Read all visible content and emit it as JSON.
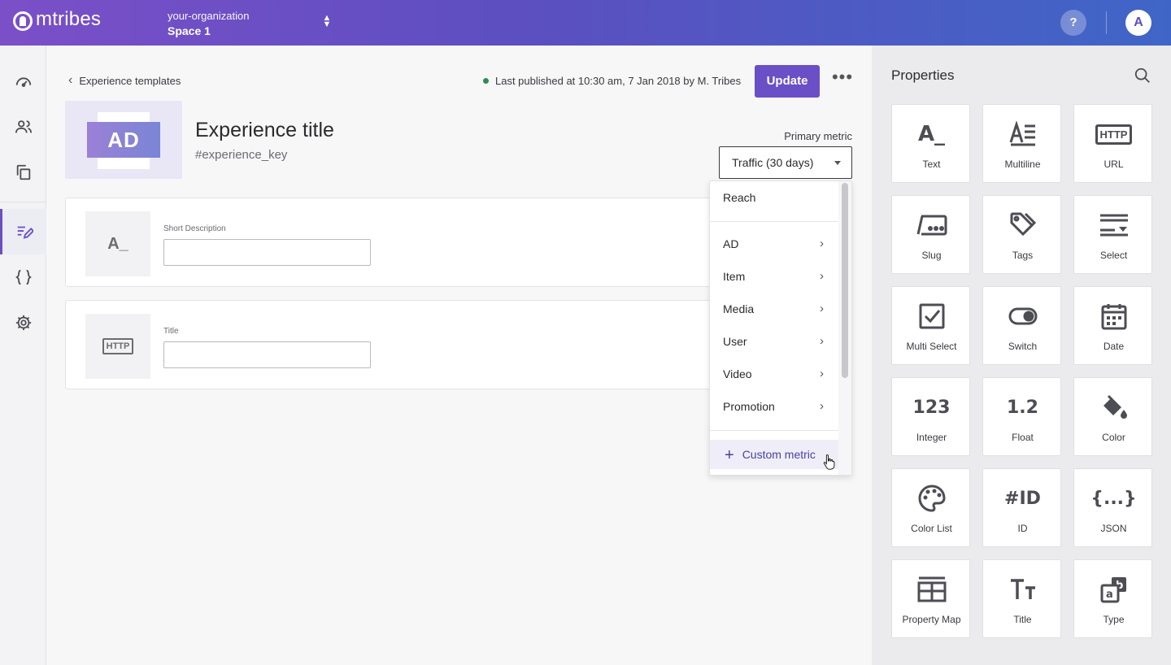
{
  "app": {
    "brand": "mtribes",
    "organization": "your-organization",
    "space": "Space 1",
    "help_label": "?",
    "avatar_initial": "A",
    "brand_color": "#6a4fc6"
  },
  "rail": {
    "items": [
      {
        "name": "dashboard",
        "icon": "gauge-icon"
      },
      {
        "name": "users",
        "icon": "users-icon"
      },
      {
        "name": "collections",
        "icon": "copy-icon"
      },
      {
        "name": "experience-templates",
        "icon": "edit-list-icon",
        "active": true
      },
      {
        "name": "code",
        "icon": "braces-icon"
      },
      {
        "name": "settings",
        "icon": "gear-icon"
      }
    ]
  },
  "header": {
    "back_label": "Experience templates",
    "published_text": "Last published at 10:30 am, 7 Jan 2018 by M. Tribes",
    "update_label": "Update",
    "more_label": "•••"
  },
  "experience": {
    "thumbnail_text": "AD",
    "title": "Experience title",
    "key": "#experience_key"
  },
  "primary_metric": {
    "label": "Primary metric",
    "value": "Traffic (30 days)"
  },
  "dropdown": {
    "top_item": "Reach",
    "groups": [
      "AD",
      "Item",
      "Media",
      "User",
      "Video",
      "Promotion"
    ],
    "custom_label": "Custom metric"
  },
  "fields": [
    {
      "icon_text": "A_",
      "label": "Short Description",
      "value": ""
    },
    {
      "icon_text": "HTTP",
      "label": "Title",
      "value": ""
    }
  ],
  "properties": {
    "title": "Properties",
    "items": [
      {
        "label": "Text",
        "icon": "text-icon"
      },
      {
        "label": "Multiline",
        "icon": "multiline-icon"
      },
      {
        "label": "URL",
        "icon": "http-icon"
      },
      {
        "label": "Slug",
        "icon": "slug-icon"
      },
      {
        "label": "Tags",
        "icon": "tags-icon"
      },
      {
        "label": "Select",
        "icon": "select-icon"
      },
      {
        "label": "Multi Select",
        "icon": "checkbox-icon"
      },
      {
        "label": "Switch",
        "icon": "toggle-icon"
      },
      {
        "label": "Date",
        "icon": "calendar-icon"
      },
      {
        "label": "Integer",
        "icon": "integer-icon",
        "glyph": "123"
      },
      {
        "label": "Float",
        "icon": "float-icon",
        "glyph": "1.2"
      },
      {
        "label": "Color",
        "icon": "paint-bucket-icon"
      },
      {
        "label": "Color List",
        "icon": "palette-icon"
      },
      {
        "label": "ID",
        "icon": "id-icon",
        "glyph": "#ID"
      },
      {
        "label": "JSON",
        "icon": "json-icon",
        "glyph": "{...}"
      },
      {
        "label": "Property Map",
        "icon": "table-icon"
      },
      {
        "label": "Title",
        "icon": "title-icon",
        "glyph": "Tт"
      },
      {
        "label": "Type",
        "icon": "type-icon"
      }
    ]
  }
}
